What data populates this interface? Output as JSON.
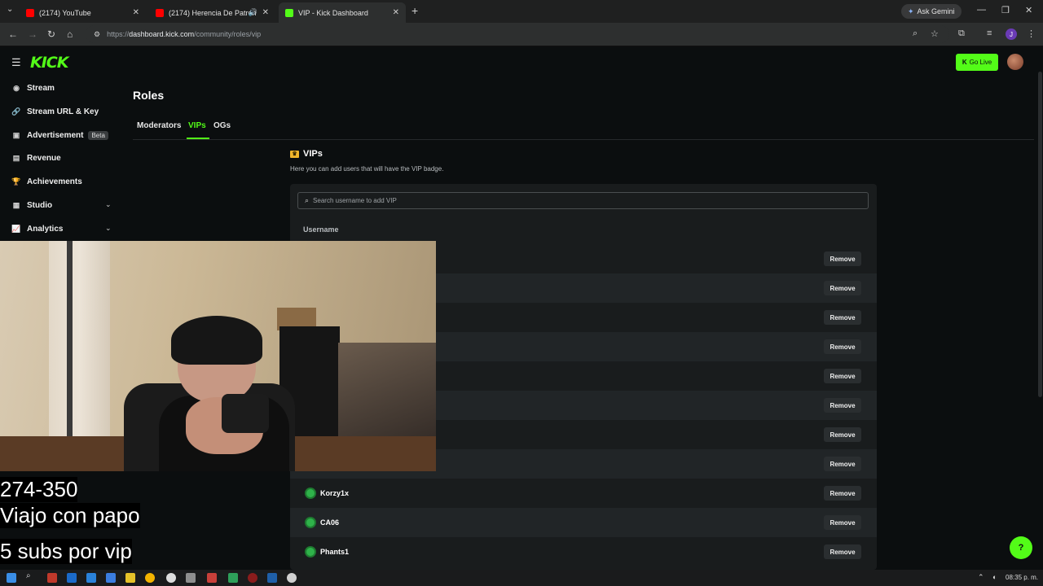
{
  "browser": {
    "tabs": [
      {
        "title": "(2174) YouTube",
        "favicon_color": "#ff0000"
      },
      {
        "title": "(2174) Herencia De Patron",
        "favicon_color": "#ff0000"
      },
      {
        "title": "VIP - Kick Dashboard",
        "favicon_color": "#53fc18"
      }
    ],
    "ask_gemini": "Ask Gemini",
    "url_prefix": "https://",
    "url_host": "dashboard.kick.com",
    "url_path": "/community/roles/vip",
    "profile_initial": "J"
  },
  "app": {
    "logo": "KICK",
    "go_live": "Go Live",
    "accent": "#53fc18",
    "sidebar": [
      {
        "label": "Stream",
        "icon": "broadcast-icon"
      },
      {
        "label": "Stream URL & Key",
        "icon": "link-icon"
      },
      {
        "label": "Advertisement",
        "icon": "ad-icon",
        "badge": "Beta"
      },
      {
        "label": "Revenue",
        "icon": "revenue-icon"
      },
      {
        "label": "Achievements",
        "icon": "trophy-icon"
      },
      {
        "label": "Studio",
        "icon": "studio-icon",
        "expandable": true
      },
      {
        "label": "Analytics",
        "icon": "analytics-icon",
        "expandable": true
      }
    ],
    "page_title": "Roles",
    "role_tabs": [
      "Moderators",
      "VIPs",
      "OGs"
    ],
    "active_tab": "VIPs",
    "section": {
      "title": "VIPs",
      "subtitle": "Here you can add users that will have the VIP badge."
    },
    "search": {
      "placeholder": "Search username to add VIP",
      "value": ""
    },
    "column_header": "Username",
    "remove_label": "Remove",
    "rows": [
      "",
      "",
      "",
      "",
      "",
      "",
      "",
      "",
      "Korzy1x",
      "CA06",
      "Phants1"
    ]
  },
  "overlay": {
    "line1": "274-350",
    "line2": "Viajo con papo",
    "line3": "5 subs por vip"
  },
  "taskbar": {
    "time": "08:35 p. m."
  }
}
